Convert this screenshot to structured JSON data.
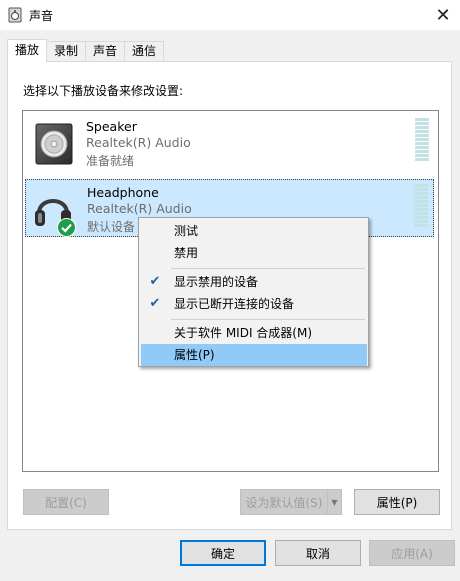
{
  "window": {
    "title": "声音",
    "close_glyph": "✕"
  },
  "tabs": [
    {
      "label": "播放",
      "active": true
    },
    {
      "label": "录制",
      "active": false
    },
    {
      "label": "声音",
      "active": false
    },
    {
      "label": "通信",
      "active": false
    }
  ],
  "instruction": "选择以下播放设备来修改设置:",
  "devices": [
    {
      "name": "Speaker",
      "driver": "Realtek(R) Audio",
      "status": "准备就绪",
      "icon": "speaker-icon",
      "selected": false
    },
    {
      "name": "Headphone",
      "driver": "Realtek(R) Audio",
      "status": "默认设备",
      "icon": "headphone-icon",
      "selected": true,
      "default_badge": "check-badge-icon"
    }
  ],
  "context_menu": {
    "items": [
      {
        "label": "测试",
        "checked": false
      },
      {
        "label": "禁用",
        "checked": false
      },
      {
        "label": "显示禁用的设备",
        "checked": true
      },
      {
        "label": "显示已断开连接的设备",
        "checked": true
      },
      {
        "label": "关于软件 MIDI 合成器(M)",
        "checked": false
      },
      {
        "label": "属性(P)",
        "checked": false,
        "highlighted": true
      }
    ],
    "check_glyph": "✔"
  },
  "panel_buttons": {
    "configure": "配置(C)",
    "set_default": "设为默认值(S)",
    "properties": "属性(P)"
  },
  "dialog_buttons": {
    "ok": "确定",
    "cancel": "取消",
    "apply": "应用(A)"
  },
  "colors": {
    "accent": "#0078d7",
    "selection": "#cce8ff",
    "menu_highlight": "#91c9f7",
    "check_green": "#1e9e4a"
  }
}
